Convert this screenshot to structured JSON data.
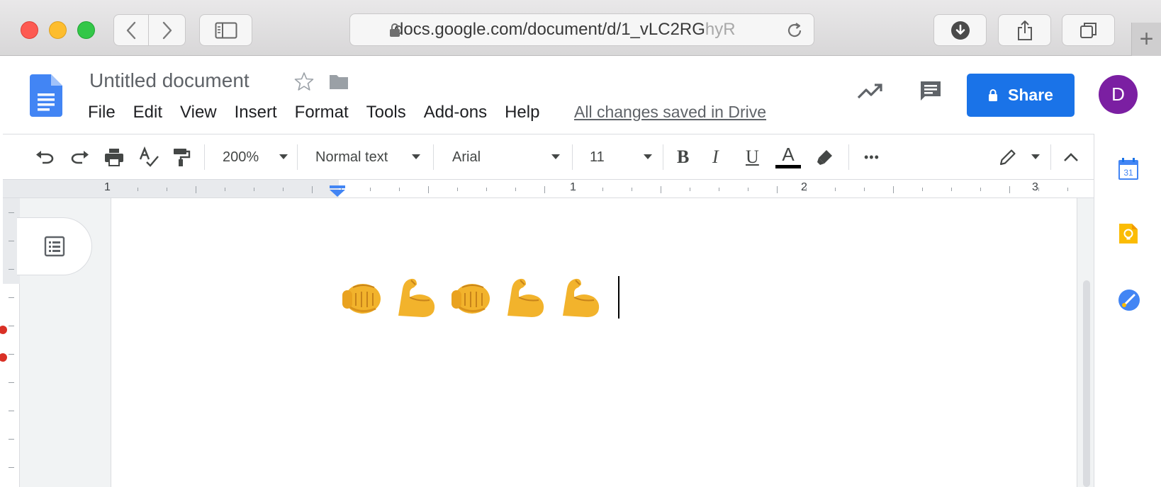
{
  "browser": {
    "url_visible": "docs.google.com/document/d/1_vLC2RG",
    "url_faded": "hyR",
    "new_tab_label": "+",
    "controls": [
      "back",
      "forward",
      "sidebar",
      "download",
      "share",
      "tabs"
    ]
  },
  "doc": {
    "title": "Untitled document",
    "saved_status": "All changes saved in Drive",
    "menu": [
      "File",
      "Edit",
      "View",
      "Insert",
      "Format",
      "Tools",
      "Add-ons",
      "Help"
    ],
    "share_label": "Share",
    "avatar_letter": "D",
    "colors": {
      "share": "#1a73e8",
      "avatar": "#7b1fa2",
      "docs_blue": "#4285f4"
    }
  },
  "toolbar": {
    "zoom": "200%",
    "style": "Normal text",
    "font": "Arial",
    "font_size": "11",
    "bold": "B",
    "italic": "I",
    "underline": "U",
    "text_color": "A",
    "more": "•••",
    "icons": [
      "undo-icon",
      "redo-icon",
      "print-icon",
      "spellcheck-icon",
      "paint-format-icon",
      "highlighter-icon",
      "pencil-icon",
      "collapse-icon"
    ]
  },
  "ruler": {
    "labels": [
      "1",
      "1",
      "2",
      "3"
    ]
  },
  "content": {
    "emojis": [
      "👊",
      "💪",
      "👊",
      "💪",
      "💪"
    ]
  },
  "side_panel": {
    "calendar_day": "31",
    "apps": [
      "calendar-icon",
      "keep-icon",
      "tasks-icon"
    ]
  }
}
